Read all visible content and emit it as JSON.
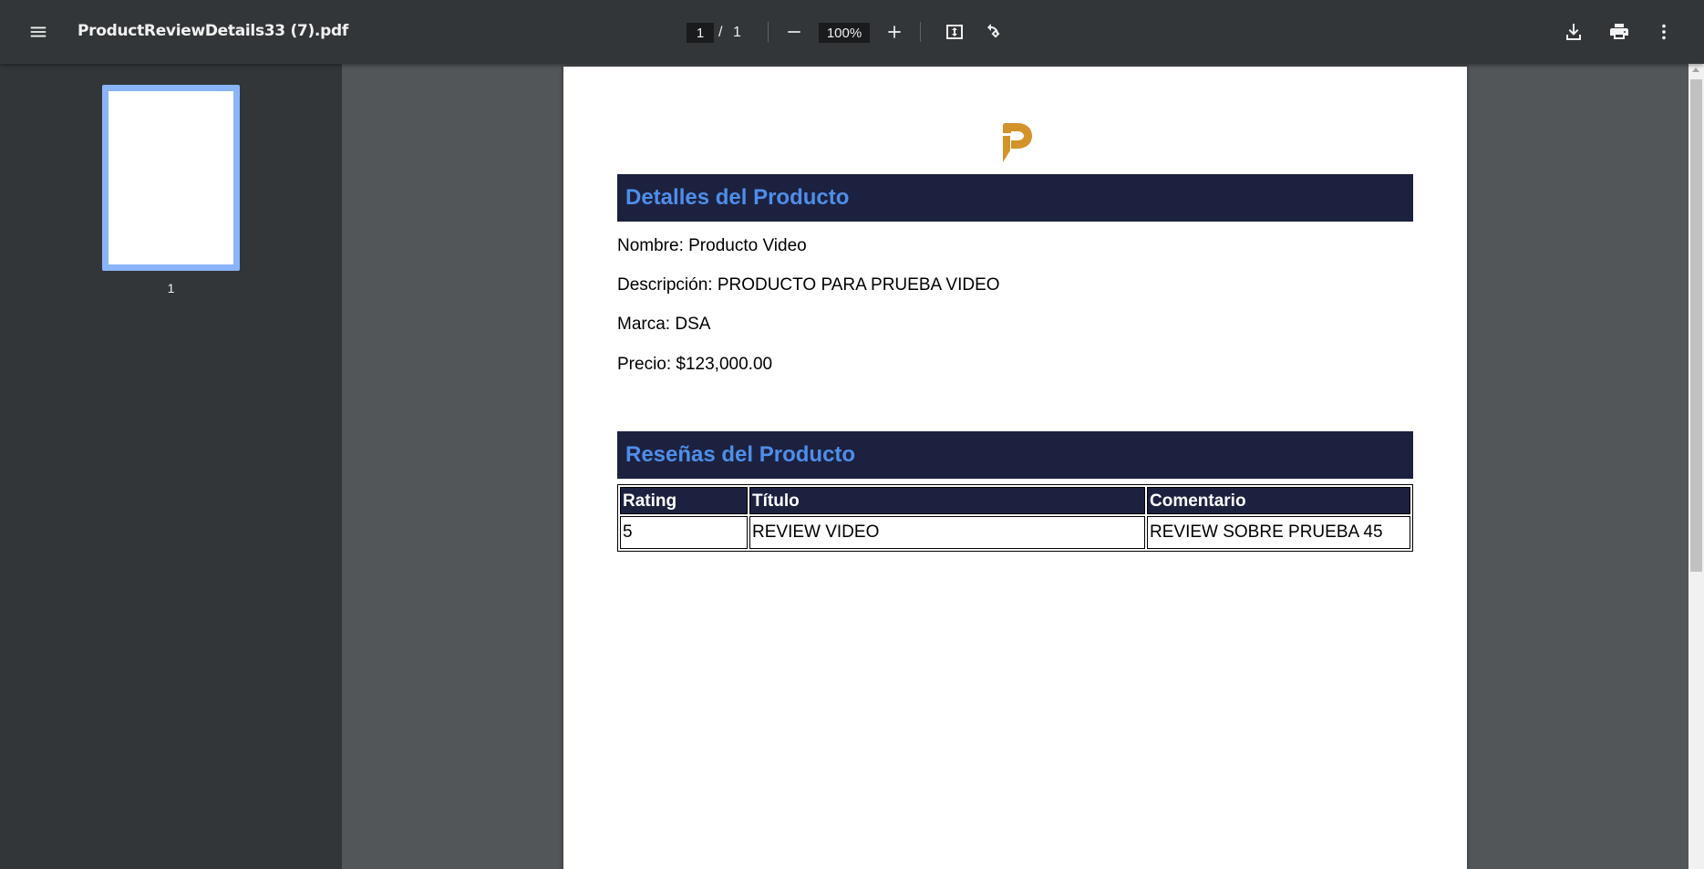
{
  "toolbar": {
    "menu_icon": "menu-icon",
    "title": "ProductReviewDetails33 (7).pdf",
    "page_current": "1",
    "page_separator": "/",
    "page_total": "1",
    "zoom": "100%",
    "icons": [
      "zoom-out-icon",
      "zoom-in-icon",
      "fit-to-page-icon",
      "rotate-icon",
      "download-icon",
      "print-icon",
      "more-options-icon"
    ]
  },
  "sidebar": {
    "thumbnails": [
      {
        "label": "1"
      }
    ]
  },
  "document": {
    "logo_icon": "brand-p-logo",
    "details_heading": "Detalles del Producto",
    "fields": [
      "Nombre: Producto Video",
      "Descripción: PRODUCTO PARA PRUEBA VIDEO",
      "Marca: DSA",
      "Precio: $123,000.00"
    ],
    "reviews_heading": "Reseñas del Producto",
    "table": {
      "headers": [
        "Rating",
        "Título",
        "Comentario"
      ],
      "rows": [
        [
          "5",
          "REVIEW VIDEO",
          "REVIEW SOBRE PRUEBA 45"
        ]
      ]
    }
  },
  "colors": {
    "toolbar_bg": "#323639",
    "viewer_bg": "#525659",
    "section_bar_bg": "#1c2140",
    "section_title": "#4f8ee8",
    "thumbnail_border": "#8ab4f8",
    "logo": "#d4922a"
  }
}
